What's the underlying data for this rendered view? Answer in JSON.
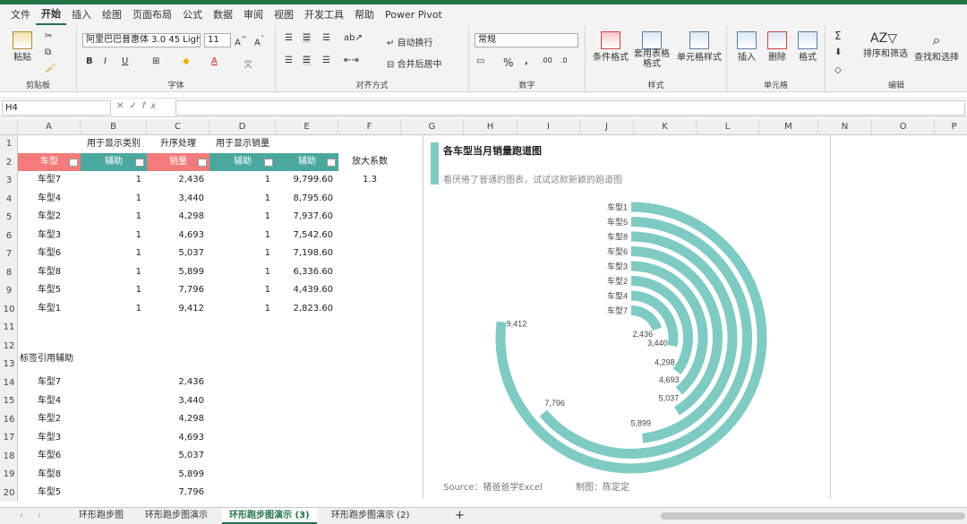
{
  "menu": [
    "文件",
    "开始",
    "插入",
    "绘图",
    "页面布局",
    "公式",
    "数据",
    "审阅",
    "视图",
    "开发工具",
    "帮助",
    "Power Pivot"
  ],
  "ribbon": {
    "paste": "粘贴",
    "font_name": "阿里巴巴普惠体 3.0 45 Light",
    "font_size": "11",
    "wrap_text": "自动换行",
    "merge_center": "合并后居中",
    "number_format": "常规",
    "cond_format": "条件格式",
    "table_format": "套用表格格式",
    "cell_style": "单元格样式",
    "insert": "插入",
    "delete": "删除",
    "format": "格式",
    "sort_filter": "排序和筛选",
    "find_select": "查找和选择",
    "groups": [
      "剪贴板",
      "字体",
      "对齐方式",
      "数字",
      "样式",
      "单元格",
      "编辑"
    ]
  },
  "formula_bar": {
    "name_box": "H4",
    "fx": "fx",
    "content": ""
  },
  "columns": [
    "A",
    "B",
    "C",
    "D",
    "E",
    "F",
    "G",
    "H",
    "I",
    "J",
    "K",
    "L",
    "M",
    "N",
    "O",
    "P"
  ],
  "rows": [
    "1",
    "2",
    "3",
    "4",
    "5",
    "6",
    "7",
    "8",
    "9",
    "10",
    "11",
    "12",
    "13",
    "14",
    "15",
    "16",
    "17",
    "18",
    "19",
    "20"
  ],
  "sheet": {
    "row1": {
      "b": "用于显示类别",
      "c": "升序处理",
      "d": "用于显示销量"
    },
    "headers": {
      "a": "车型",
      "b": "辅助",
      "c": "销量",
      "d": "辅助",
      "e": "辅助",
      "f": "放大系数"
    },
    "factor": "1.3",
    "table": [
      {
        "car": "车型7",
        "b": "1",
        "sales": "2,436",
        "d": "1",
        "e": "9,799.60"
      },
      {
        "car": "车型4",
        "b": "1",
        "sales": "3,440",
        "d": "1",
        "e": "8,795.60"
      },
      {
        "car": "车型2",
        "b": "1",
        "sales": "4,298",
        "d": "1",
        "e": "7,937.60"
      },
      {
        "car": "车型3",
        "b": "1",
        "sales": "4,693",
        "d": "1",
        "e": "7,542.60"
      },
      {
        "car": "车型6",
        "b": "1",
        "sales": "5,037",
        "d": "1",
        "e": "7,198.60"
      },
      {
        "car": "车型8",
        "b": "1",
        "sales": "5,899",
        "d": "1",
        "e": "6,336.60"
      },
      {
        "car": "车型5",
        "b": "1",
        "sales": "7,796",
        "d": "1",
        "e": "4,439.60"
      },
      {
        "car": "车型1",
        "b": "1",
        "sales": "9,412",
        "d": "1",
        "e": "2,823.60"
      }
    ],
    "label_title": "标签引用辅助",
    "labels": [
      {
        "car": "车型7",
        "sales": "2,436"
      },
      {
        "car": "车型4",
        "sales": "3,440"
      },
      {
        "car": "车型2",
        "sales": "4,298"
      },
      {
        "car": "车型3",
        "sales": "4,693"
      },
      {
        "car": "车型6",
        "sales": "5,037"
      },
      {
        "car": "车型8",
        "sales": "5,899"
      },
      {
        "car": "车型5",
        "sales": "7,796"
      }
    ]
  },
  "chart_data": {
    "type": "radial-bar",
    "title": "各车型当月销量跑道图",
    "subtitle": "看厌倦了普通的图表，试试这款新颖的跑道图",
    "source": "Source：猪爸爸学Excel",
    "author": "制图：陈定定",
    "color": "#7fcbc3",
    "max_total": 12235.6,
    "categories": [
      "车型1",
      "车型5",
      "车型8",
      "车型6",
      "车型3",
      "车型2",
      "车型4",
      "车型7"
    ],
    "values": [
      9412,
      7796,
      5899,
      5037,
      4693,
      4298,
      3440,
      2436
    ],
    "value_labels": [
      "9,412",
      "7,796",
      "5,899",
      "5,037",
      "4,693",
      "4,298",
      "3,440",
      "2,436"
    ]
  },
  "sheet_tabs": [
    "环形跑步图",
    "环形跑步图演示",
    "环形跑步图演示 (3)",
    "环形跑步图演示 (2)"
  ],
  "active_tab": 2
}
